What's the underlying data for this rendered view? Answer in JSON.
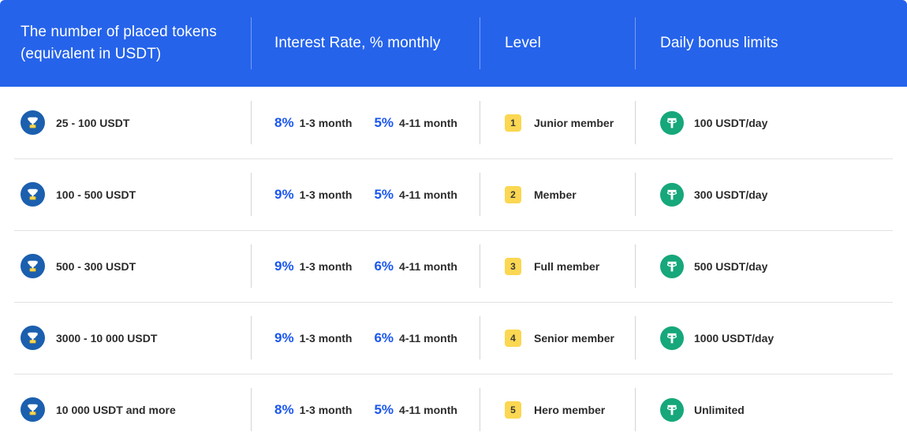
{
  "theme": {
    "header_bg": "#2563EB",
    "accent_blue": "#1A56F0",
    "badge_yellow": "#FBD752",
    "tether_green": "#16A77A",
    "trophy_blue": "#1B5FAF",
    "text_dark": "#2B2B2B",
    "row_divider": "#E2E2E2"
  },
  "table": {
    "columns": [
      {
        "label": "The number of placed tokens (equivalent in USDT)",
        "line1": "The number of placed tokens",
        "line2": "(equivalent in USDT)"
      },
      {
        "label": "Interest Rate, % monthly"
      },
      {
        "label": "Level"
      },
      {
        "label": "Daily bonus limits"
      }
    ],
    "rows": [
      {
        "tokens": "25 - 100 USDT",
        "tokens_icon": "trophy-icon",
        "rates": [
          {
            "pct": "8%",
            "term": "1-3 month"
          },
          {
            "pct": "5%",
            "term": "4-11 month"
          }
        ],
        "level_number": "1",
        "level_name": "Junior member",
        "bonus_icon": "tether-icon",
        "bonus_limit": "100 USDT/day"
      },
      {
        "tokens": "100 - 500 USDT",
        "tokens_icon": "trophy-icon",
        "rates": [
          {
            "pct": "9%",
            "term": "1-3 month"
          },
          {
            "pct": "5%",
            "term": "4-11 month"
          }
        ],
        "level_number": "2",
        "level_name": "Member",
        "bonus_icon": "tether-icon",
        "bonus_limit": "300 USDT/day"
      },
      {
        "tokens": "500 - 300 USDT",
        "tokens_icon": "trophy-icon",
        "rates": [
          {
            "pct": "9%",
            "term": "1-3 month"
          },
          {
            "pct": "6%",
            "term": "4-11 month"
          }
        ],
        "level_number": "3",
        "level_name": "Full member",
        "bonus_icon": "tether-icon",
        "bonus_limit": "500 USDT/day"
      },
      {
        "tokens": "3000 - 10 000 USDT",
        "tokens_icon": "trophy-icon",
        "rates": [
          {
            "pct": "9%",
            "term": "1-3 month"
          },
          {
            "pct": "6%",
            "term": "4-11 month"
          }
        ],
        "level_number": "4",
        "level_name": "Senior member",
        "bonus_icon": "tether-icon",
        "bonus_limit": "1000 USDT/day"
      },
      {
        "tokens": "10 000 USDT and more",
        "tokens_icon": "trophy-icon",
        "rates": [
          {
            "pct": "8%",
            "term": "1-3 month"
          },
          {
            "pct": "5%",
            "term": "4-11 month"
          }
        ],
        "level_number": "5",
        "level_name": "Hero member",
        "bonus_icon": "tether-icon",
        "bonus_limit": "Unlimited"
      }
    ]
  }
}
